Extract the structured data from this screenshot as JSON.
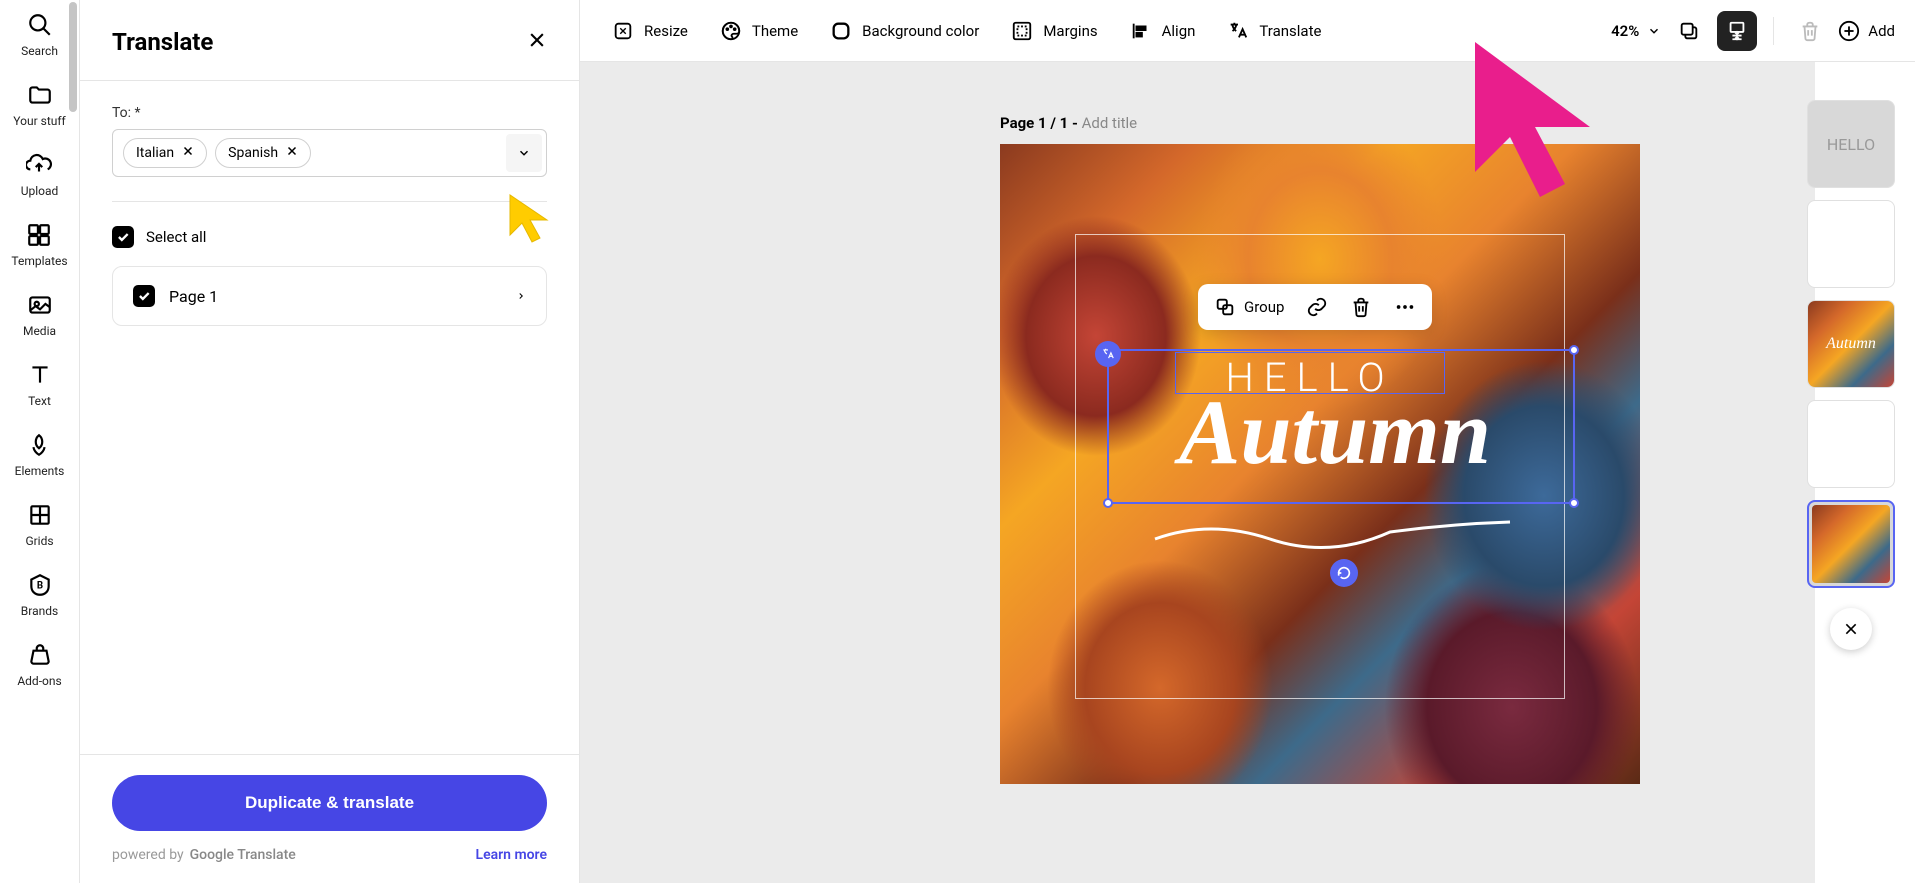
{
  "leftNav": {
    "items": [
      {
        "label": "Search",
        "icon": "search"
      },
      {
        "label": "Your stuff",
        "icon": "folder"
      },
      {
        "label": "Upload",
        "icon": "upload"
      },
      {
        "label": "Templates",
        "icon": "templates"
      },
      {
        "label": "Media",
        "icon": "media"
      },
      {
        "label": "Text",
        "icon": "text"
      },
      {
        "label": "Elements",
        "icon": "elements"
      },
      {
        "label": "Grids",
        "icon": "grids"
      },
      {
        "label": "Brands",
        "icon": "brands"
      },
      {
        "label": "Add-ons",
        "icon": "addons"
      }
    ]
  },
  "translatePanel": {
    "title": "Translate",
    "toLabel": "To: *",
    "languages": [
      {
        "name": "Italian"
      },
      {
        "name": "Spanish"
      }
    ],
    "selectAll": "Select all",
    "pages": [
      {
        "label": "Page 1",
        "checked": true
      }
    ],
    "duplicateBtn": "Duplicate & translate",
    "poweredBy": "powered by",
    "googleTranslate": "Google Translate",
    "learnMore": "Learn more"
  },
  "topToolbar": {
    "resize": "Resize",
    "theme": "Theme",
    "backgroundColor": "Background color",
    "margins": "Margins",
    "align": "Align",
    "translate": "Translate",
    "zoom": "42%",
    "add": "Add"
  },
  "canvas": {
    "pagePrefix": "Page 1 / 1 - ",
    "addTitle": "Add title",
    "helloText": "HELLO",
    "autumnText": "Autumn"
  },
  "floatingToolbar": {
    "group": "Group"
  },
  "thumbnails": {
    "hello": "HELLO",
    "autumn": "Autumn"
  }
}
